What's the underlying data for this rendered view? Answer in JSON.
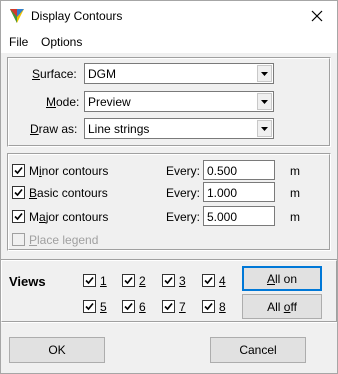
{
  "window": {
    "title": "Display Contours",
    "close_icon": "close-icon"
  },
  "menu": {
    "file": "File",
    "options": "Options"
  },
  "settings": {
    "surface_label_u": "S",
    "surface_label_rest": "urface:",
    "surface_value": "DGM",
    "mode_label_u": "M",
    "mode_label_rest": "ode:",
    "mode_value": "Preview",
    "draw_label_u": "D",
    "draw_label_rest": "raw as:",
    "draw_value": "Line strings"
  },
  "contours": {
    "minor_label_pre": "M",
    "minor_label_u": "i",
    "minor_label_rest": "nor contours",
    "minor_checked": true,
    "minor_every": "Every:",
    "minor_value": "0.500",
    "minor_unit": "m",
    "basic_label_u": "B",
    "basic_label_rest": "asic contours",
    "basic_checked": true,
    "basic_every": "Every:",
    "basic_value": "1.000",
    "basic_unit": "m",
    "major_label_pre": "M",
    "major_label_u": "a",
    "major_label_rest": "jor contours",
    "major_checked": true,
    "major_every": "Every:",
    "major_value": "5.000",
    "major_unit": "m",
    "legend_label_u": "P",
    "legend_label_rest": "lace legend",
    "legend_checked": false
  },
  "views": {
    "title": "Views",
    "items": [
      "1",
      "2",
      "3",
      "4",
      "5",
      "6",
      "7",
      "8"
    ],
    "all_on_u": "A",
    "all_on_rest": "ll on",
    "all_off_pre": "All ",
    "all_off_u": "o",
    "all_off_rest": "ff"
  },
  "footer": {
    "ok": "OK",
    "cancel": "Cancel"
  }
}
